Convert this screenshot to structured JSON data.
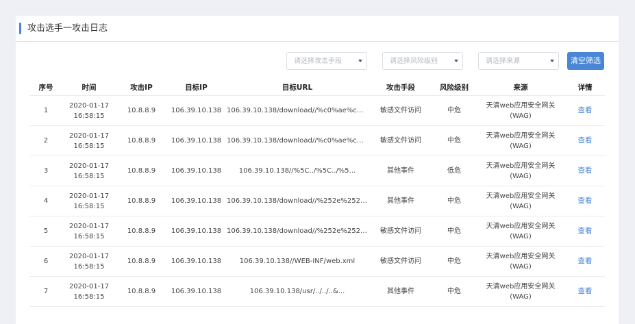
{
  "card": {
    "title": "攻击选手一攻击日志"
  },
  "filters": {
    "attack_method_placeholder": "请选择攻击手段",
    "risk_level_placeholder": "请选择风险级别",
    "source_placeholder": "请选择来源",
    "clear_label": "清空筛选"
  },
  "table": {
    "headers": [
      "序号",
      "时间",
      "攻击IP",
      "目标IP",
      "目标URL",
      "攻击手段",
      "风险级别",
      "来源",
      "详情"
    ],
    "rows": [
      {
        "index": "1",
        "date": "2020-01-17",
        "time": "16:58:15",
        "attack_ip": "10.8.8.9",
        "target_ip": "106.39.10.138",
        "url": "106.39.10.138/download//%c0%ae%c0%...",
        "method": "敏感文件访问",
        "risk": "中危",
        "source_line1": "天清web应用安全网关",
        "source_line2": "(WAG)",
        "detail": "查看"
      },
      {
        "index": "2",
        "date": "2020-01-17",
        "time": "16:58:15",
        "attack_ip": "10.8.8.9",
        "target_ip": "106.39.10.138",
        "url": "106.39.10.138/download//%c0%ae%c0%...",
        "method": "敏感文件访问",
        "risk": "中危",
        "source_line1": "天清web应用安全网关",
        "source_line2": "(WAG)",
        "detail": "查看"
      },
      {
        "index": "3",
        "date": "2020-01-17",
        "time": "16:58:15",
        "attack_ip": "10.8.8.9",
        "target_ip": "106.39.10.138",
        "url": "106.39.10.138//%5C../%5C../%5...",
        "method": "其他事件",
        "risk": "低危",
        "source_line1": "天清web应用安全网关",
        "source_line2": "(WAG)",
        "detail": "查看"
      },
      {
        "index": "4",
        "date": "2020-01-17",
        "time": "16:58:15",
        "attack_ip": "10.8.8.9",
        "target_ip": "106.39.10.138",
        "url": "106.39.10.138/download//%252e%252e...",
        "method": "其他事件",
        "risk": "中危",
        "source_line1": "天清web应用安全网关",
        "source_line2": "(WAG)",
        "detail": "查看"
      },
      {
        "index": "5",
        "date": "2020-01-17",
        "time": "16:58:15",
        "attack_ip": "10.8.8.9",
        "target_ip": "106.39.10.138",
        "url": "106.39.10.138/download//%252e%252e...",
        "method": "敏感文件访问",
        "risk": "中危",
        "source_line1": "天清web应用安全网关",
        "source_line2": "(WAG)",
        "detail": "查看"
      },
      {
        "index": "6",
        "date": "2020-01-17",
        "time": "16:58:15",
        "attack_ip": "10.8.8.9",
        "target_ip": "106.39.10.138",
        "url": "106.39.10.138//WEB-INF/web.xml",
        "method": "敏感文件访问",
        "risk": "中危",
        "source_line1": "天清web应用安全网关",
        "source_line2": "(WAG)",
        "detail": "查看"
      },
      {
        "index": "7",
        "date": "2020-01-17",
        "time": "16:58:15",
        "attack_ip": "10.8.8.9",
        "target_ip": "106.39.10.138",
        "url": "106.39.10.138/usr/../../..&...",
        "method": "其他事件",
        "risk": "中危",
        "source_line1": "天清web应用安全网关",
        "source_line2": "(WAG)",
        "detail": "查看"
      }
    ]
  },
  "colors": {
    "accent": "#4a86d6",
    "background": "#eef0f6"
  }
}
